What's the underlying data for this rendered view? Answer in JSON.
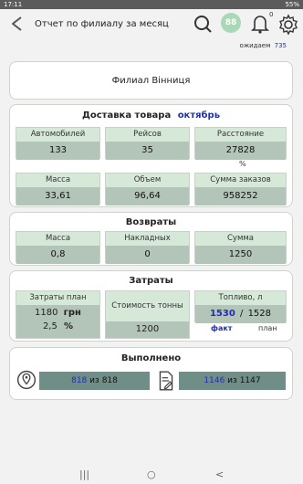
{
  "status": {
    "time": "17:11",
    "battery": "55%"
  },
  "header": {
    "title": "Отчет по филиалу за месяц",
    "notifications_badge": "0",
    "avatar_text": "88"
  },
  "waiting": {
    "label": "ожидаем",
    "count": "735"
  },
  "branch": {
    "name": "Филиал Вінниця"
  },
  "delivery": {
    "title": "Доставка товара",
    "month": "октябрь",
    "cars": {
      "label": "Автомобилей",
      "value": "133"
    },
    "trips": {
      "label": "Рейсов",
      "value": "35"
    },
    "distance": {
      "label": "Расстояние",
      "value": "27828"
    },
    "percent_sign": "%",
    "mass": {
      "label": "Масса",
      "value": "33,61"
    },
    "volume": {
      "label": "Объем",
      "value": "96,64"
    },
    "orders_sum": {
      "label": "Сумма заказов",
      "value": "958252"
    }
  },
  "returns": {
    "title": "Возвраты",
    "mass": {
      "label": "Масса",
      "value": "0,8"
    },
    "invoices": {
      "label": "Накладных",
      "value": "0"
    },
    "sum": {
      "label": "Сумма",
      "value": "1250"
    }
  },
  "costs": {
    "title": "Затраты",
    "plan_label": "Затраты план",
    "plan_value": "1180",
    "plan_unit": "грн",
    "plan_percent": "2,5",
    "percent_sign": "%",
    "ton_label": "Стоимость тонны",
    "ton_value": "1200",
    "fuel_label": "Топливо, л",
    "fuel_fact": "1530",
    "fuel_sep": "/",
    "fuel_plan": "1528",
    "fact_label": "факт",
    "plan_label_small": "план"
  },
  "done": {
    "title": "Выполнено",
    "left": {
      "done": "818",
      "sep": "из",
      "total": "818"
    },
    "right": {
      "done": "1146",
      "sep": "из",
      "total": "1147"
    }
  },
  "nav": {
    "recent": "|||",
    "home": "○",
    "back": "<"
  }
}
